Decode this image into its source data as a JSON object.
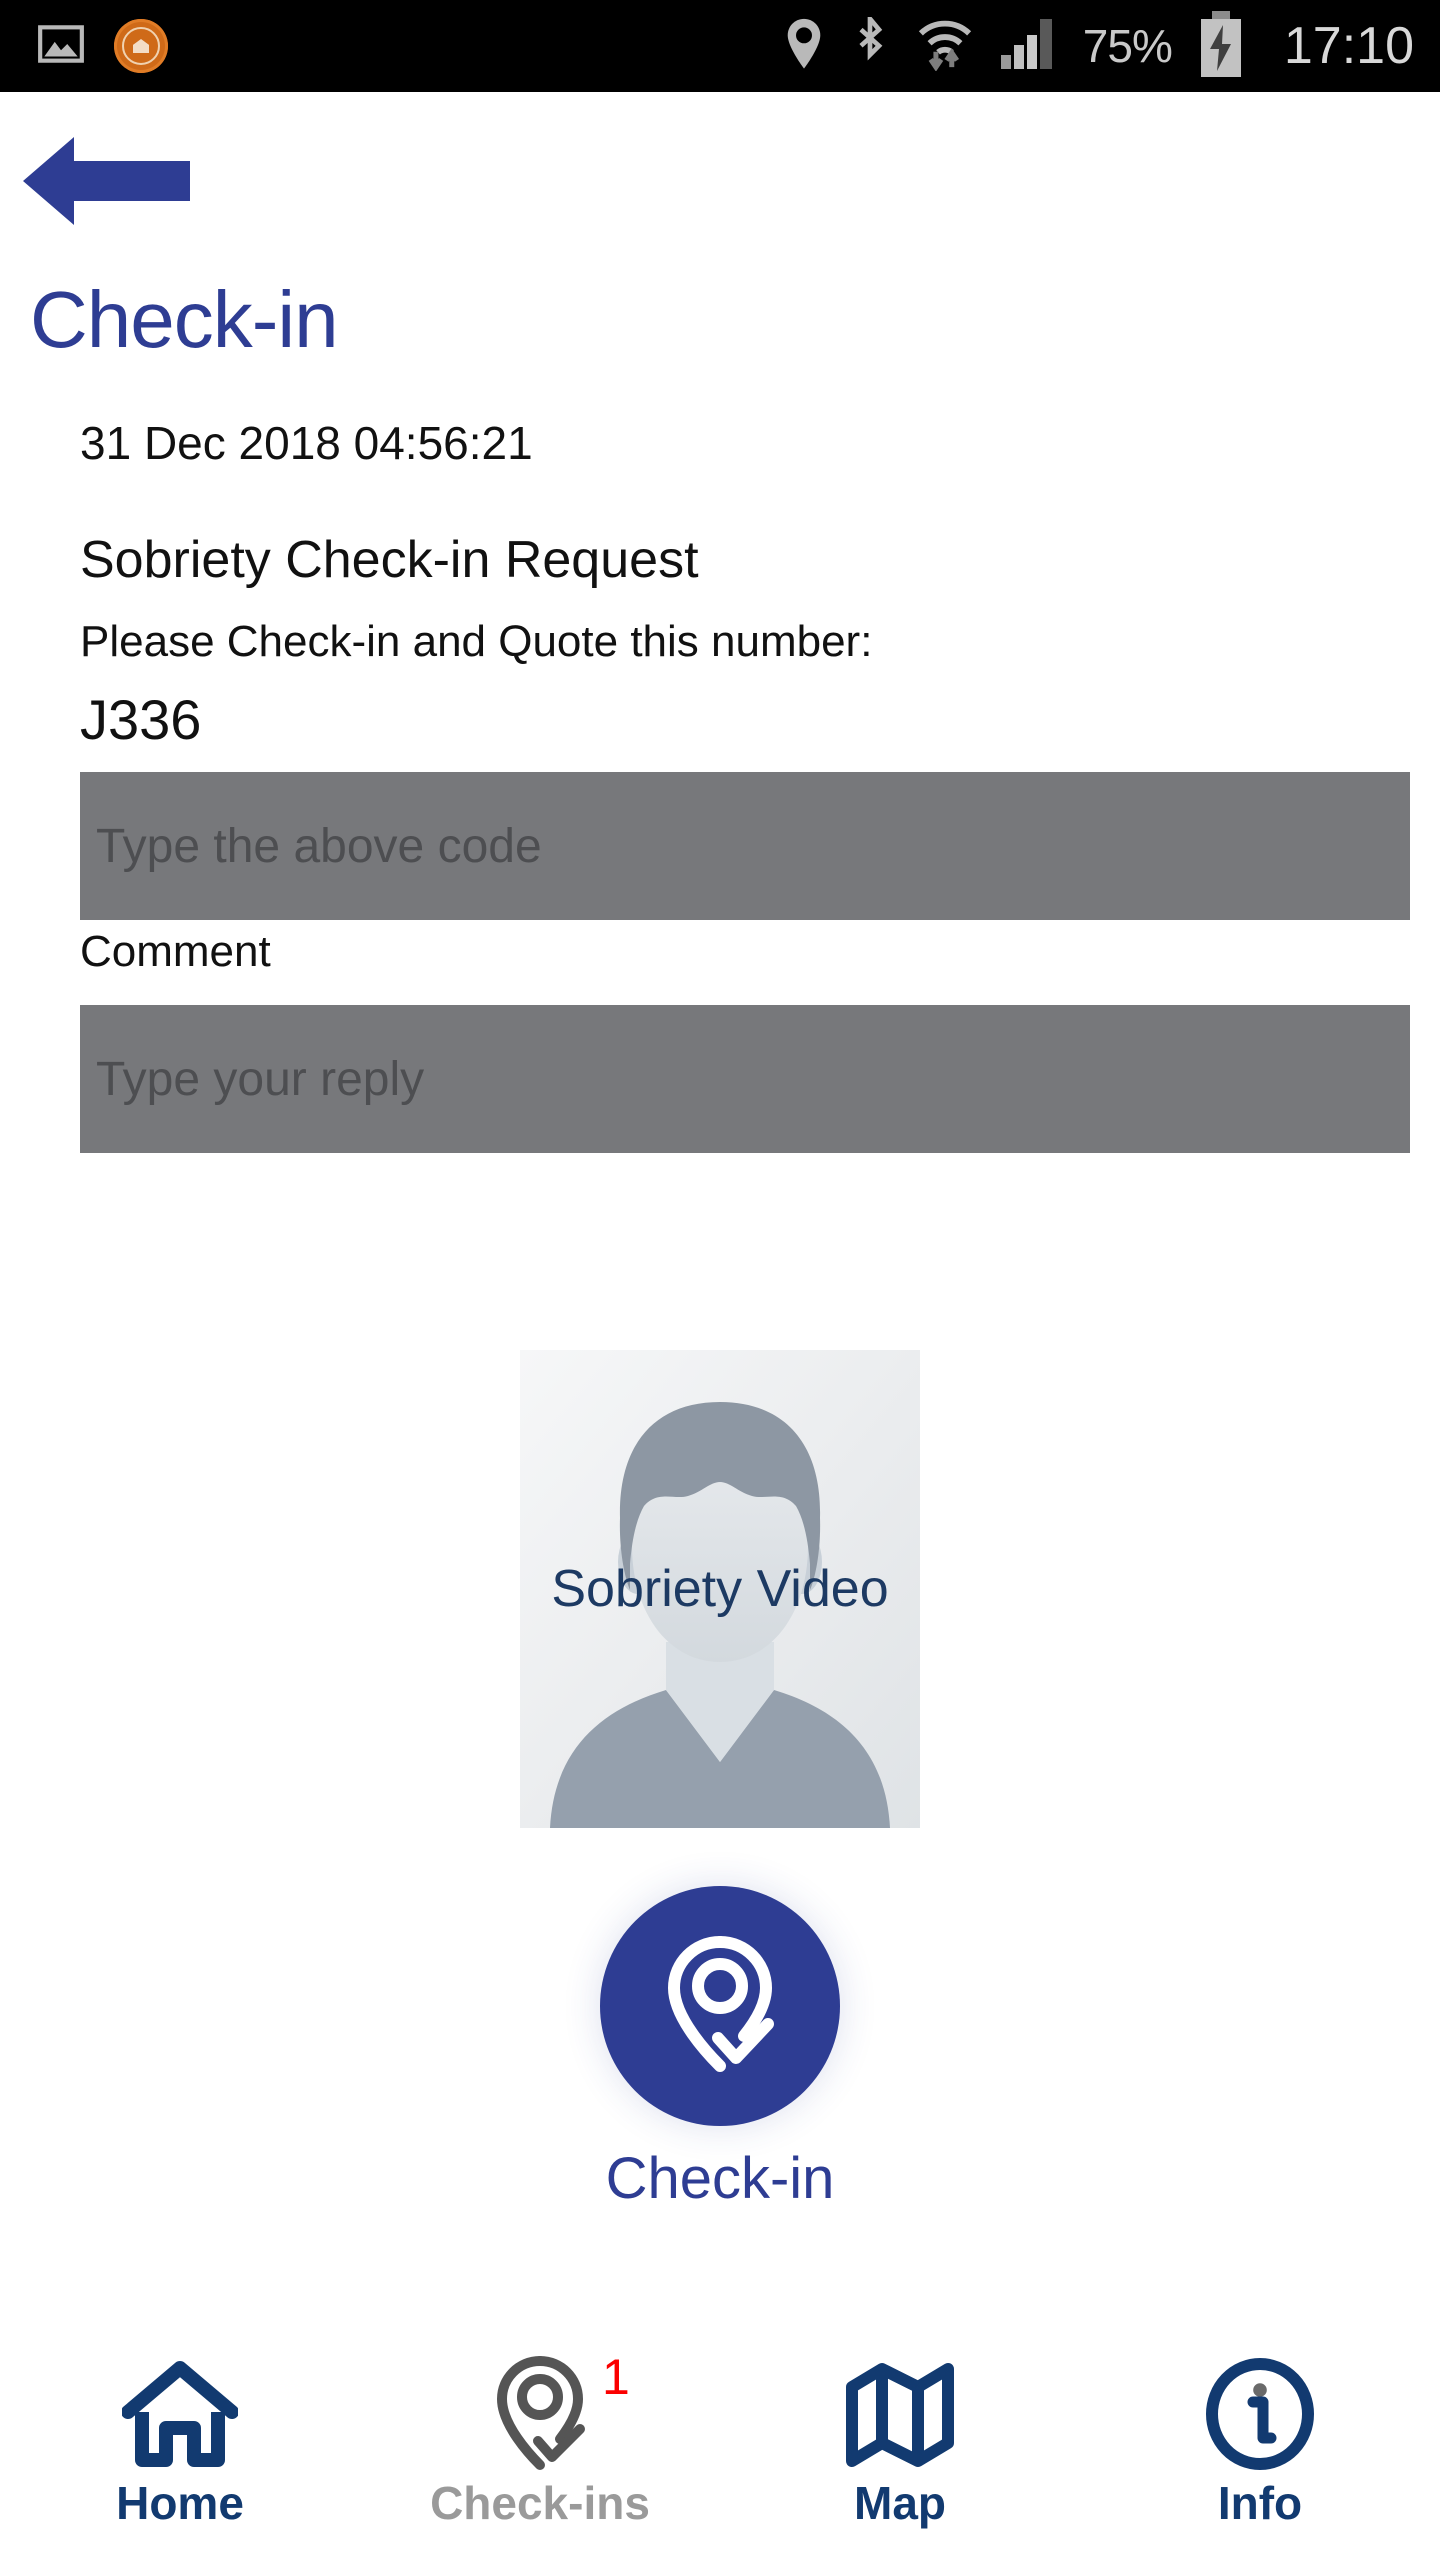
{
  "statusbar": {
    "icons_left": [
      "image-icon",
      "ecell-logo-icon"
    ],
    "icons_right": [
      "location-pin-icon",
      "bluetooth-icon",
      "wifi-icon",
      "signal-bars-icon"
    ],
    "battery_percent": "75%",
    "battery_icon": "battery-charging-icon",
    "time": "17:10"
  },
  "header": {
    "back_icon": "back-arrow-icon",
    "title": "Check-in"
  },
  "content": {
    "datetime": "31 Dec 2018 04:56:21",
    "request_title": "Sobriety Check-in Request",
    "request_instruction": "Please Check-in and Quote this number:",
    "code": "J336"
  },
  "form": {
    "code_input": {
      "value": "",
      "placeholder": "Type the above code"
    },
    "comment_label": "Comment",
    "comment_input": {
      "value": "",
      "placeholder": "Type your reply"
    }
  },
  "video": {
    "label": "Sobriety Video",
    "icon": "person-avatar-placeholder-icon"
  },
  "action": {
    "icon": "location-pin-check-icon",
    "label": "Check-in"
  },
  "bottom_nav": [
    {
      "label": "Home",
      "icon": "home-icon",
      "active": true,
      "badge": ""
    },
    {
      "label": "Check-ins",
      "icon": "location-pin-check-icon",
      "active": false,
      "badge": "1"
    },
    {
      "label": "Map",
      "icon": "map-folded-icon",
      "active": true,
      "badge": ""
    },
    {
      "label": "Info",
      "icon": "info-circle-icon",
      "active": true,
      "badge": ""
    }
  ],
  "colors": {
    "brand_blue": "#2e3d93",
    "nav_blue": "#123a70",
    "nav_inactive": "#9a9a9a",
    "badge_red": "#fb0000",
    "field_gray": "#77787b",
    "statusbar_bg": "#000000"
  }
}
